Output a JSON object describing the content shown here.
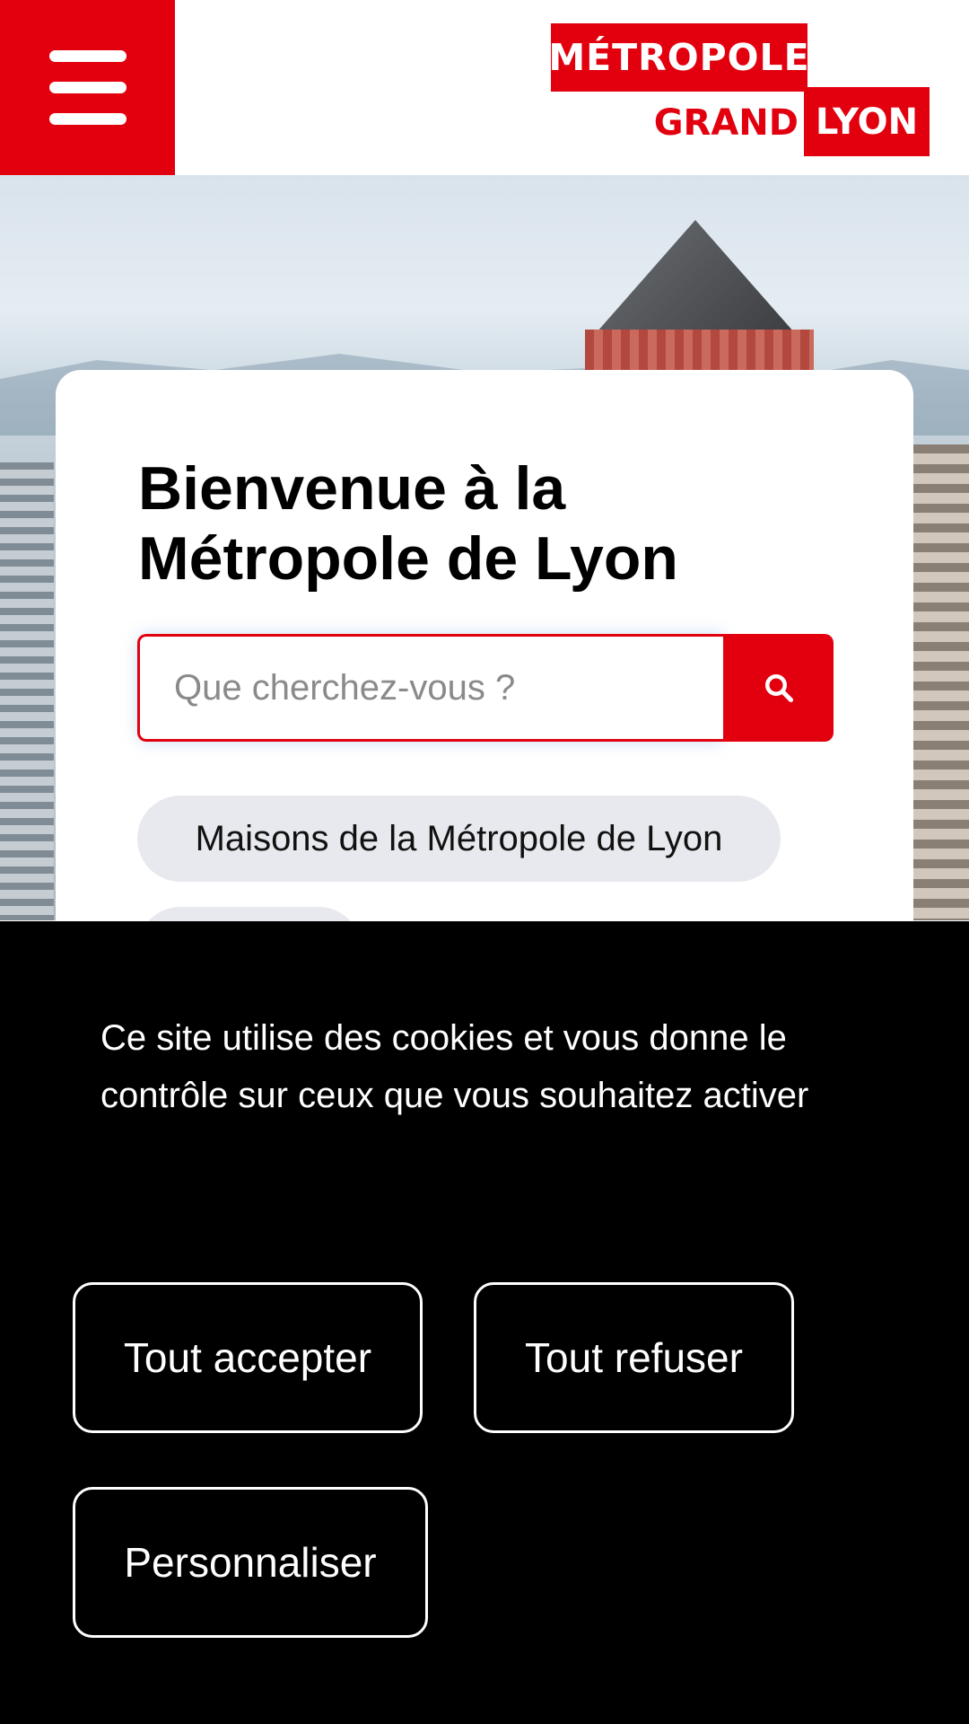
{
  "header": {
    "menu_icon": "hamburger-menu-icon",
    "logo": {
      "line1": "MÉTROPOLE",
      "line2a": "GRAND",
      "line2b": "LYON"
    },
    "brand_color": "#e2000f"
  },
  "hero": {
    "title": "Bienvenue à la Métropole de Lyon",
    "search": {
      "placeholder": "Que cherchez-vous ?",
      "value": "",
      "button_icon": "search-icon"
    },
    "quick_links": [
      {
        "label": "Maisons de la Métropole de Lyon"
      }
    ]
  },
  "cookie_banner": {
    "message": "Ce site utilise des cookies et vous donne le contrôle sur ceux que vous souhaitez activer",
    "accept_label": "Tout accepter",
    "refuse_label": "Tout refuser",
    "customize_label": "Personnaliser"
  }
}
